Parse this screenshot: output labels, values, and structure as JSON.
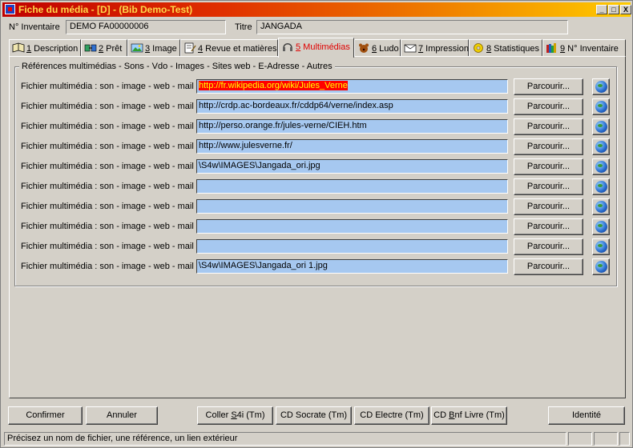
{
  "window": {
    "title": "Fiche du média - [D] - (Bib Demo-Test)",
    "min_label": "_",
    "max_label": "□",
    "close_label": "X"
  },
  "header": {
    "inventaire_label": "N° Inventaire",
    "inventaire_value": "DEMO FA00000006",
    "titre_label": "Titre",
    "titre_value": "JANGADA"
  },
  "tabs": [
    {
      "num": "1",
      "label": " Description",
      "icon": "book-icon"
    },
    {
      "num": "2",
      "label": " Prêt",
      "icon": "transfer-icon"
    },
    {
      "num": "3",
      "label": " Image",
      "icon": "picture-icon"
    },
    {
      "num": "4",
      "label": " Revue et matières",
      "icon": "notepad-icon"
    },
    {
      "num": "5",
      "label": " Multimédias",
      "icon": "headphones-icon",
      "active": true
    },
    {
      "num": "6",
      "label": " Ludo",
      "icon": "bear-icon"
    },
    {
      "num": "7",
      "label": " Impression",
      "icon": "envelope-icon"
    },
    {
      "num": "8",
      "label": " Statistiques",
      "icon": "gear-icon"
    },
    {
      "num": "9",
      "label": " N° Inventaire",
      "icon": "books-icon"
    }
  ],
  "group": {
    "title": "Références multimédias - Sons - Vdo - Images - Sites web - E-Adresse - Autres"
  },
  "rows": [
    {
      "label": "Fichier multimédia : son - image - web - mail",
      "value": "http://fr.wikipedia.org/wiki/Jules_Verne",
      "browse": "Parcourir...",
      "selected": true
    },
    {
      "label": "Fichier multimédia : son - image - web - mail",
      "value": "http://crdp.ac-bordeaux.fr/cddp64/verne/index.asp",
      "browse": "Parcourir..."
    },
    {
      "label": "Fichier multimédia : son - image - web - mail",
      "value": "http://perso.orange.fr/jules-verne/CIEH.htm",
      "browse": "Parcourir..."
    },
    {
      "label": "Fichier multimédia : son - image - web - mail",
      "value": "http://www.julesverne.fr/",
      "browse": "Parcourir..."
    },
    {
      "label": "Fichier multimédia : son - image - web - mail",
      "value": "\\S4w\\IMAGES\\Jangada_ori.jpg",
      "browse": "Parcourir..."
    },
    {
      "label": "Fichier multimédia : son - image - web - mail",
      "value": "",
      "browse": "Parcourir..."
    },
    {
      "label": "Fichier multimédia : son - image - web - mail",
      "value": "",
      "browse": "Parcourir..."
    },
    {
      "label": "Fichier multimédia : son - image - web - mail",
      "value": "",
      "browse": "Parcourir..."
    },
    {
      "label": "Fichier multimédia : son - image - web - mail",
      "value": "",
      "browse": "Parcourir..."
    },
    {
      "label": "Fichier multimédia : son - image - web - mail",
      "value": "\\S4w\\IMAGES\\Jangada_ori 1.jpg",
      "browse": "Parcourir..."
    }
  ],
  "footer": {
    "confirmer": "Confirmer",
    "annuler": "Annuler",
    "coller_s4i_pre": "Coller ",
    "coller_s4i_u": "S",
    "coller_s4i_post": "4i (Tm)",
    "cd_socrate": "CD Socrate (Tm)",
    "cd_electre": "CD Electre (Tm)",
    "cd_bnf_pre": "CD ",
    "cd_bnf_u": "B",
    "cd_bnf_post": "nf Livre (Tm)",
    "identite": "Identité"
  },
  "status": {
    "message": "Précisez un nom de fichier, une référence, un lien extérieur"
  },
  "colors": {
    "url_field_bg": "#a6c8f0",
    "selected_bg": "#ff0000",
    "selected_fg": "#ffff00",
    "active_tab_fg": "#e00000"
  }
}
